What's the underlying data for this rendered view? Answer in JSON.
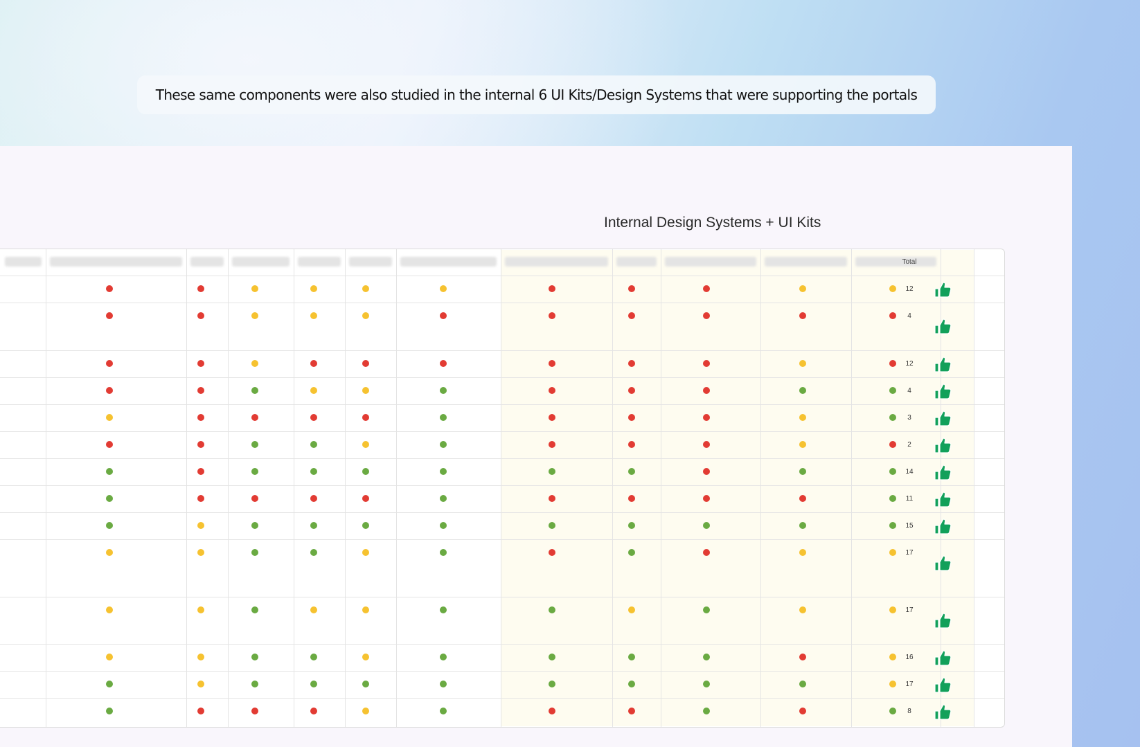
{
  "caption": "These same components were also studied in the internal 6 UI Kits/Design Systems that were supporting the portals",
  "section_title": "Internal Design Systems + UI Kits",
  "total_label": "Total",
  "colors": {
    "red": "#e23b33",
    "yellow": "#f6c230",
    "green": "#6aaa42",
    "thumb": "#12a05a",
    "highlight": "#fefcf0"
  },
  "thumb_icon": "thumbs-up-icon",
  "rows": [
    {
      "status": [
        "red",
        "red",
        "yellow",
        "yellow",
        "yellow",
        "yellow",
        "red",
        "red",
        "red",
        "yellow",
        "yellow"
      ],
      "total": "12"
    },
    {
      "status": [
        "red",
        "red",
        "yellow",
        "yellow",
        "yellow",
        "red",
        "red",
        "red",
        "red",
        "red",
        "red"
      ],
      "total": "4"
    },
    {
      "status": [
        "red",
        "red",
        "yellow",
        "red",
        "red",
        "red",
        "red",
        "red",
        "red",
        "yellow",
        "red"
      ],
      "total": "12"
    },
    {
      "status": [
        "red",
        "red",
        "green",
        "yellow",
        "yellow",
        "green",
        "red",
        "red",
        "red",
        "green",
        "green"
      ],
      "total": "4"
    },
    {
      "status": [
        "yellow",
        "red",
        "red",
        "red",
        "red",
        "green",
        "red",
        "red",
        "red",
        "yellow",
        "green"
      ],
      "total": "3"
    },
    {
      "status": [
        "red",
        "red",
        "green",
        "green",
        "yellow",
        "green",
        "red",
        "red",
        "red",
        "yellow",
        "red"
      ],
      "total": "2"
    },
    {
      "status": [
        "green",
        "red",
        "green",
        "green",
        "green",
        "green",
        "green",
        "green",
        "red",
        "green",
        "green"
      ],
      "total": "14"
    },
    {
      "status": [
        "green",
        "red",
        "red",
        "red",
        "red",
        "green",
        "red",
        "red",
        "red",
        "red",
        "green"
      ],
      "total": "11"
    },
    {
      "status": [
        "green",
        "yellow",
        "green",
        "green",
        "green",
        "green",
        "green",
        "green",
        "green",
        "green",
        "green"
      ],
      "total": "15"
    },
    {
      "status": [
        "yellow",
        "yellow",
        "green",
        "green",
        "yellow",
        "green",
        "red",
        "green",
        "red",
        "yellow",
        "yellow"
      ],
      "total": "17"
    },
    {
      "status": [
        "yellow",
        "yellow",
        "green",
        "yellow",
        "yellow",
        "green",
        "green",
        "yellow",
        "green",
        "yellow",
        "yellow"
      ],
      "total": "17"
    },
    {
      "status": [
        "yellow",
        "yellow",
        "green",
        "green",
        "yellow",
        "green",
        "green",
        "green",
        "green",
        "red",
        "yellow"
      ],
      "total": "16"
    },
    {
      "status": [
        "green",
        "yellow",
        "green",
        "green",
        "green",
        "green",
        "green",
        "green",
        "green",
        "green",
        "yellow"
      ],
      "total": "17"
    },
    {
      "status": [
        "green",
        "red",
        "red",
        "red",
        "yellow",
        "green",
        "red",
        "red",
        "green",
        "red",
        "green"
      ],
      "total": "8"
    }
  ]
}
